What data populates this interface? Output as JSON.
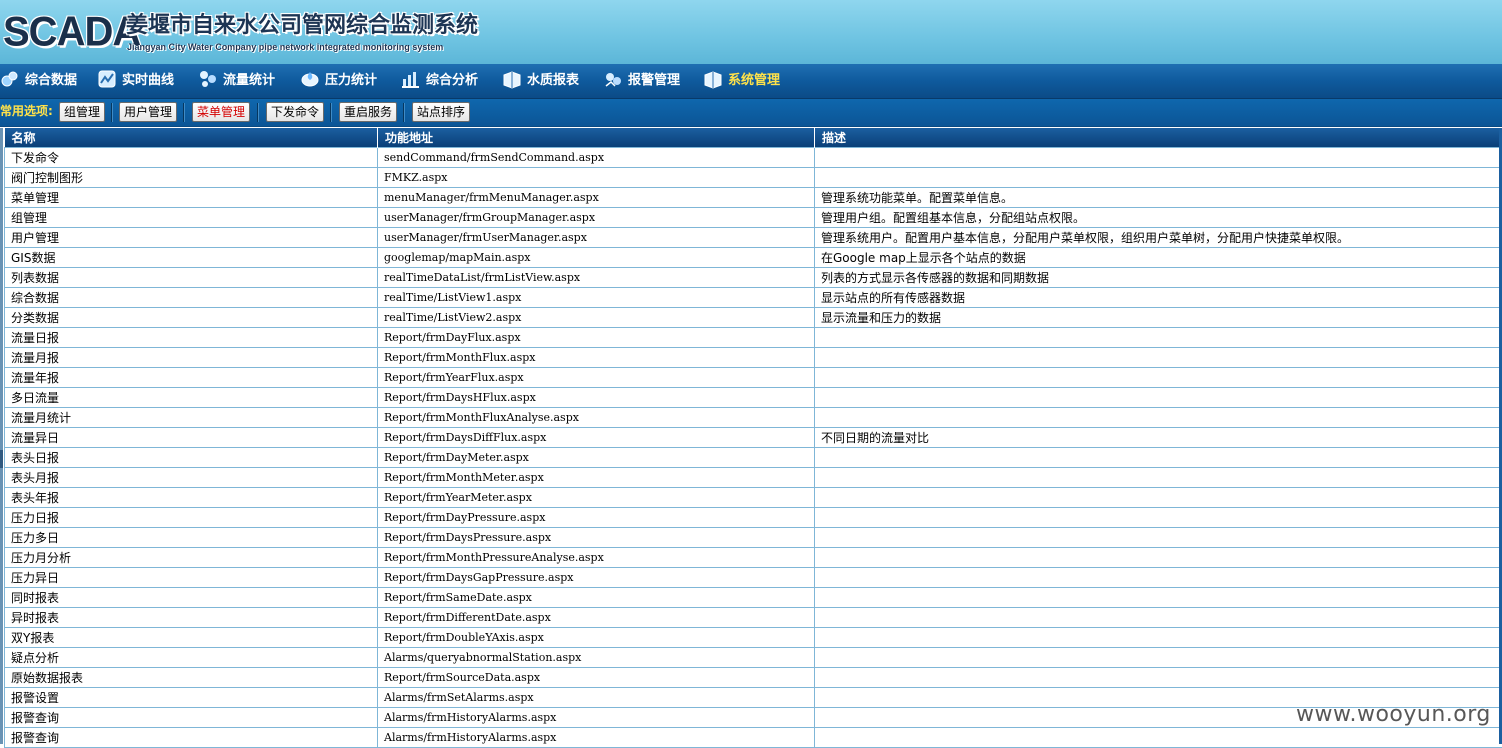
{
  "header": {
    "logo": "SCADA",
    "title": "姜堰市自来水公司管网综合监测系统",
    "subtitle": "Jiangyan City Water Company pipe network integrated monitoring system"
  },
  "nav": {
    "items": [
      {
        "label": "综合数据",
        "icon": "data-icon"
      },
      {
        "label": "实时曲线",
        "icon": "curve-icon"
      },
      {
        "label": "流量统计",
        "icon": "flow-icon"
      },
      {
        "label": "压力统计",
        "icon": "pressure-icon"
      },
      {
        "label": "综合分析",
        "icon": "analysis-icon"
      },
      {
        "label": "水质报表",
        "icon": "report-icon"
      },
      {
        "label": "报警管理",
        "icon": "alarm-icon"
      },
      {
        "label": "系统管理",
        "icon": "system-icon"
      }
    ],
    "active_index": 7
  },
  "subbar": {
    "label": "常用选项:",
    "buttons": [
      {
        "label": "组管理"
      },
      {
        "label": "用户管理"
      },
      {
        "label": "菜单管理"
      },
      {
        "label": "下发命令"
      },
      {
        "label": "重启服务"
      },
      {
        "label": "站点排序"
      }
    ],
    "active_index": 2
  },
  "table": {
    "headers": [
      "名称",
      "功能地址",
      "描述"
    ],
    "rows": [
      [
        "下发命令",
        "sendCommand/frmSendCommand.aspx",
        ""
      ],
      [
        "阀门控制图形",
        "FMKZ.aspx",
        ""
      ],
      [
        "菜单管理",
        "menuManager/frmMenuManager.aspx",
        "管理系统功能菜单。配置菜单信息。"
      ],
      [
        "组管理",
        "userManager/frmGroupManager.aspx",
        "管理用户组。配置组基本信息，分配组站点权限。"
      ],
      [
        "用户管理",
        "userManager/frmUserManager.aspx",
        "管理系统用户。配置用户基本信息，分配用户菜单权限，组织用户菜单树，分配用户快捷菜单权限。"
      ],
      [
        "GIS数据",
        "googlemap/mapMain.aspx",
        "在Google map上显示各个站点的数据"
      ],
      [
        "列表数据",
        "realTimeDataList/frmListView.aspx",
        "列表的方式显示各传感器的数据和同期数据"
      ],
      [
        "综合数据",
        "realTime/ListView1.aspx",
        "显示站点的所有传感器数据"
      ],
      [
        "分类数据",
        "realTime/ListView2.aspx",
        "显示流量和压力的数据"
      ],
      [
        "流量日报",
        "Report/frmDayFlux.aspx",
        ""
      ],
      [
        "流量月报",
        "Report/frmMonthFlux.aspx",
        ""
      ],
      [
        "流量年报",
        "Report/frmYearFlux.aspx",
        ""
      ],
      [
        "多日流量",
        "Report/frmDaysHFlux.aspx",
        ""
      ],
      [
        "流量月统计",
        "Report/frmMonthFluxAnalyse.aspx",
        ""
      ],
      [
        "流量异日",
        "Report/frmDaysDiffFlux.aspx",
        "不同日期的流量对比"
      ],
      [
        "表头日报",
        "Report/frmDayMeter.aspx",
        ""
      ],
      [
        "表头月报",
        "Report/frmMonthMeter.aspx",
        ""
      ],
      [
        "表头年报",
        "Report/frmYearMeter.aspx",
        ""
      ],
      [
        "压力日报",
        "Report/frmDayPressure.aspx",
        ""
      ],
      [
        "压力多日",
        "Report/frmDaysPressure.aspx",
        ""
      ],
      [
        "压力月分析",
        "Report/frmMonthPressureAnalyse.aspx",
        ""
      ],
      [
        "压力异日",
        "Report/frmDaysGapPressure.aspx",
        ""
      ],
      [
        "同时报表",
        "Report/frmSameDate.aspx",
        ""
      ],
      [
        "异时报表",
        "Report/frmDifferentDate.aspx",
        ""
      ],
      [
        "双Y报表",
        "Report/frmDoubleYAxis.aspx",
        ""
      ],
      [
        "疑点分析",
        "Alarms/queryabnormalStation.aspx",
        ""
      ],
      [
        "原始数据报表",
        "Report/frmSourceData.aspx",
        ""
      ],
      [
        "报警设置",
        "Alarms/frmSetAlarms.aspx",
        ""
      ],
      [
        "报警查询",
        "Alarms/frmHistoryAlarms.aspx",
        ""
      ],
      [
        "报警查询",
        "Alarms/frmHistoryAlarms.aspx",
        ""
      ]
    ]
  },
  "watermark": "www.wooyun.org",
  "colors": {
    "header_bg": "#7cc9e6",
    "nav_bg": "#0f5a9d",
    "active_text": "#ffe24a",
    "active_button_text": "#d40000",
    "table_header_bg": "#0a3f78",
    "grid_line": "#7fb6d7"
  }
}
